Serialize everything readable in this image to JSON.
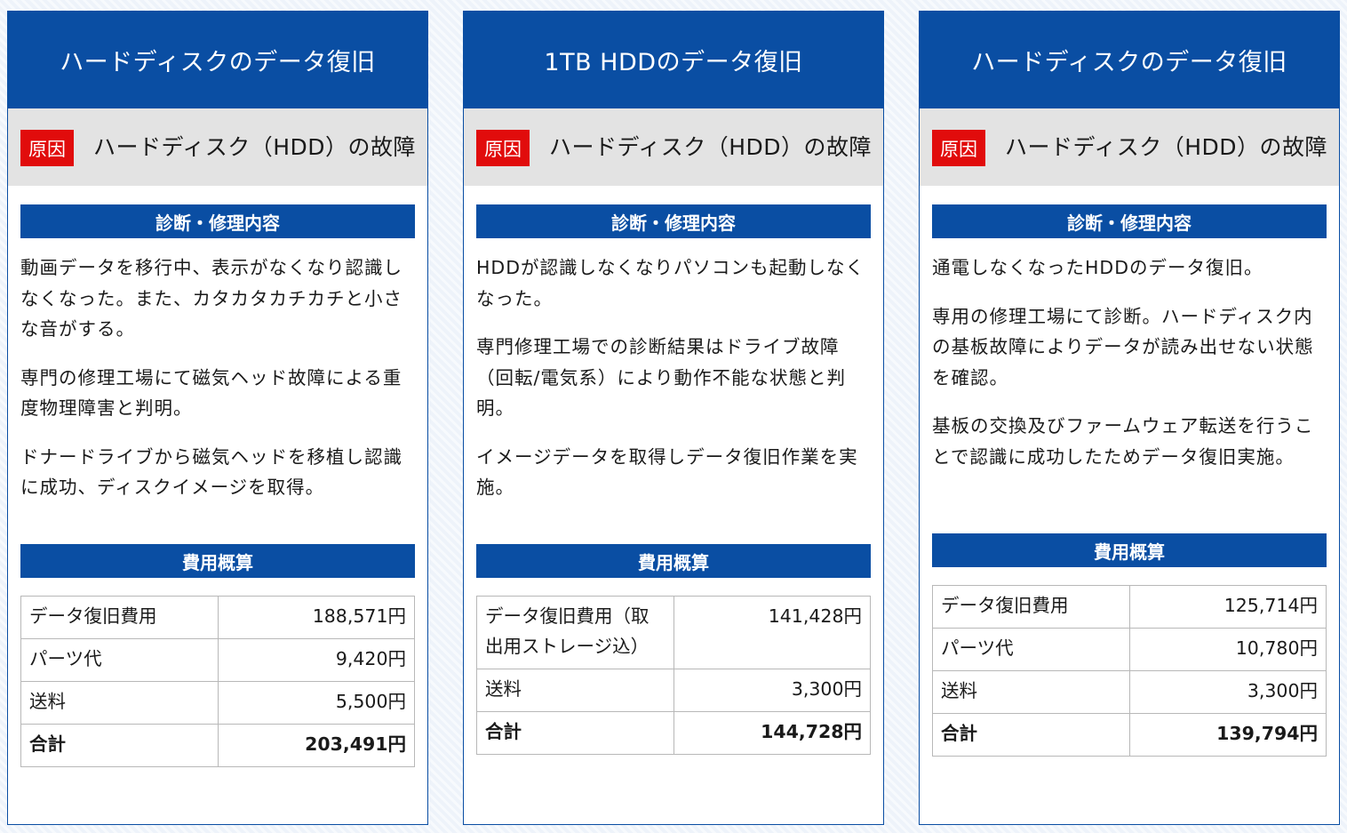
{
  "cards": [
    {
      "title": "ハードディスクのデータ復旧",
      "cause_badge": "原因",
      "cause_text": "ハードディスク（HDD）の故障",
      "diagnosis_heading": "診断・修理内容",
      "paragraphs": [
        "動画データを移行中、表示がなくなり認識しなくなった。また、カタカタカチカチと小さな音がする。",
        "専門の修理工場にて磁気ヘッド故障による重度物理障害と判明。",
        "ドナードライブから磁気ヘッドを移植し認識に成功、ディスクイメージを取得。"
      ],
      "cost_heading": "費用概算",
      "costs": [
        {
          "label": "データ復旧費用",
          "amount": "188,571円"
        },
        {
          "label": "パーツ代",
          "amount": "9,420円"
        },
        {
          "label": "送料",
          "amount": "5,500円"
        }
      ],
      "total": {
        "label": "合計",
        "amount": "203,491円"
      }
    },
    {
      "title": "1TB HDDのデータ復旧",
      "cause_badge": "原因",
      "cause_text": "ハードディスク（HDD）の故障",
      "diagnosis_heading": "診断・修理内容",
      "paragraphs": [
        "HDDが認識しなくなりパソコンも起動しなくなった。",
        "専門修理工場での診断結果はドライブ故障（回転/電気系）により動作不能な状態と判明。",
        "イメージデータを取得しデータ復旧作業を実施。"
      ],
      "cost_heading": "費用概算",
      "costs": [
        {
          "label": "データ復旧費用（取出用ストレージ込）",
          "amount": "141,428円"
        },
        {
          "label": "送料",
          "amount": "3,300円"
        }
      ],
      "total": {
        "label": "合計",
        "amount": "144,728円"
      }
    },
    {
      "title": "ハードディスクのデータ復旧",
      "cause_badge": "原因",
      "cause_text": "ハードディスク（HDD）の故障",
      "diagnosis_heading": "診断・修理内容",
      "paragraphs": [
        "通電しなくなったHDDのデータ復旧。",
        "専用の修理工場にて診断。ハードディスク内の基板故障によりデータが読み出せない状態を確認。",
        "基板の交換及びファームウェア転送を行うことで認識に成功したためデータ復旧実施。"
      ],
      "cost_heading": "費用概算",
      "costs": [
        {
          "label": "データ復旧費用",
          "amount": "125,714円"
        },
        {
          "label": "パーツ代",
          "amount": "10,780円"
        },
        {
          "label": "送料",
          "amount": "3,300円"
        }
      ],
      "total": {
        "label": "合計",
        "amount": "139,794円"
      }
    }
  ]
}
